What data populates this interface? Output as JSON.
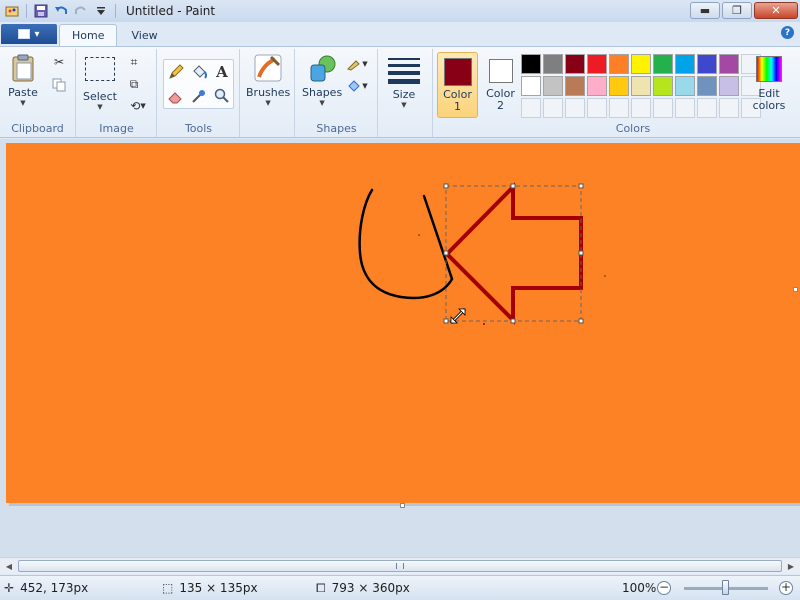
{
  "window": {
    "title": "Untitled - Paint",
    "minimize_icon": "minimize-icon",
    "maximize_icon": "restore-icon",
    "close_icon": "close-icon"
  },
  "quick_access": {
    "icons": [
      "paint-app-icon",
      "save-icon",
      "undo-icon",
      "redo-icon",
      "customize-dropdown-icon"
    ]
  },
  "tabs": [
    {
      "label": "Home",
      "active": true
    },
    {
      "label": "View",
      "active": false
    }
  ],
  "ribbon": {
    "clipboard": {
      "group_label": "Clipboard",
      "paste_label": "Paste"
    },
    "image": {
      "group_label": "Image",
      "select_label": "Select"
    },
    "tools": {
      "group_label": "Tools"
    },
    "brushes": {
      "label": "Brushes"
    },
    "shapes": {
      "group_label": "Shapes",
      "label": "Shapes"
    },
    "size": {
      "label": "Size"
    },
    "colors": {
      "group_label": "Colors",
      "color1_label_line1": "Color",
      "color1_label_line2": "1",
      "color2_label_line1": "Color",
      "color2_label_line2": "2",
      "edit_label_line1": "Edit",
      "edit_label_line2": "colors",
      "color1": "#880015",
      "color2": "#ffffff",
      "palette": [
        "#000000",
        "#7f7f7f",
        "#880015",
        "#ed1c24",
        "#ff7f27",
        "#fff200",
        "#22b14c",
        "#00a2e8",
        "#3f48cc",
        "#a349a4",
        "",
        "#ffffff",
        "#c3c3c3",
        "#b97a57",
        "#ffaec9",
        "#ffc90e",
        "#efe4b0",
        "#b5e61d",
        "#99d9ea",
        "#7092be",
        "#c8bfe7",
        "",
        "",
        "",
        "",
        "",
        "",
        "",
        "",
        "",
        "",
        "",
        ""
      ]
    }
  },
  "canvas": {
    "background": "#fd8225",
    "stroke_color": "#000000",
    "arrow_color": "#a50000"
  },
  "status": {
    "cursor_pos": "452, 173px",
    "selection_size": "135 × 135px",
    "canvas_size": "793 × 360px",
    "zoom": "100%"
  }
}
